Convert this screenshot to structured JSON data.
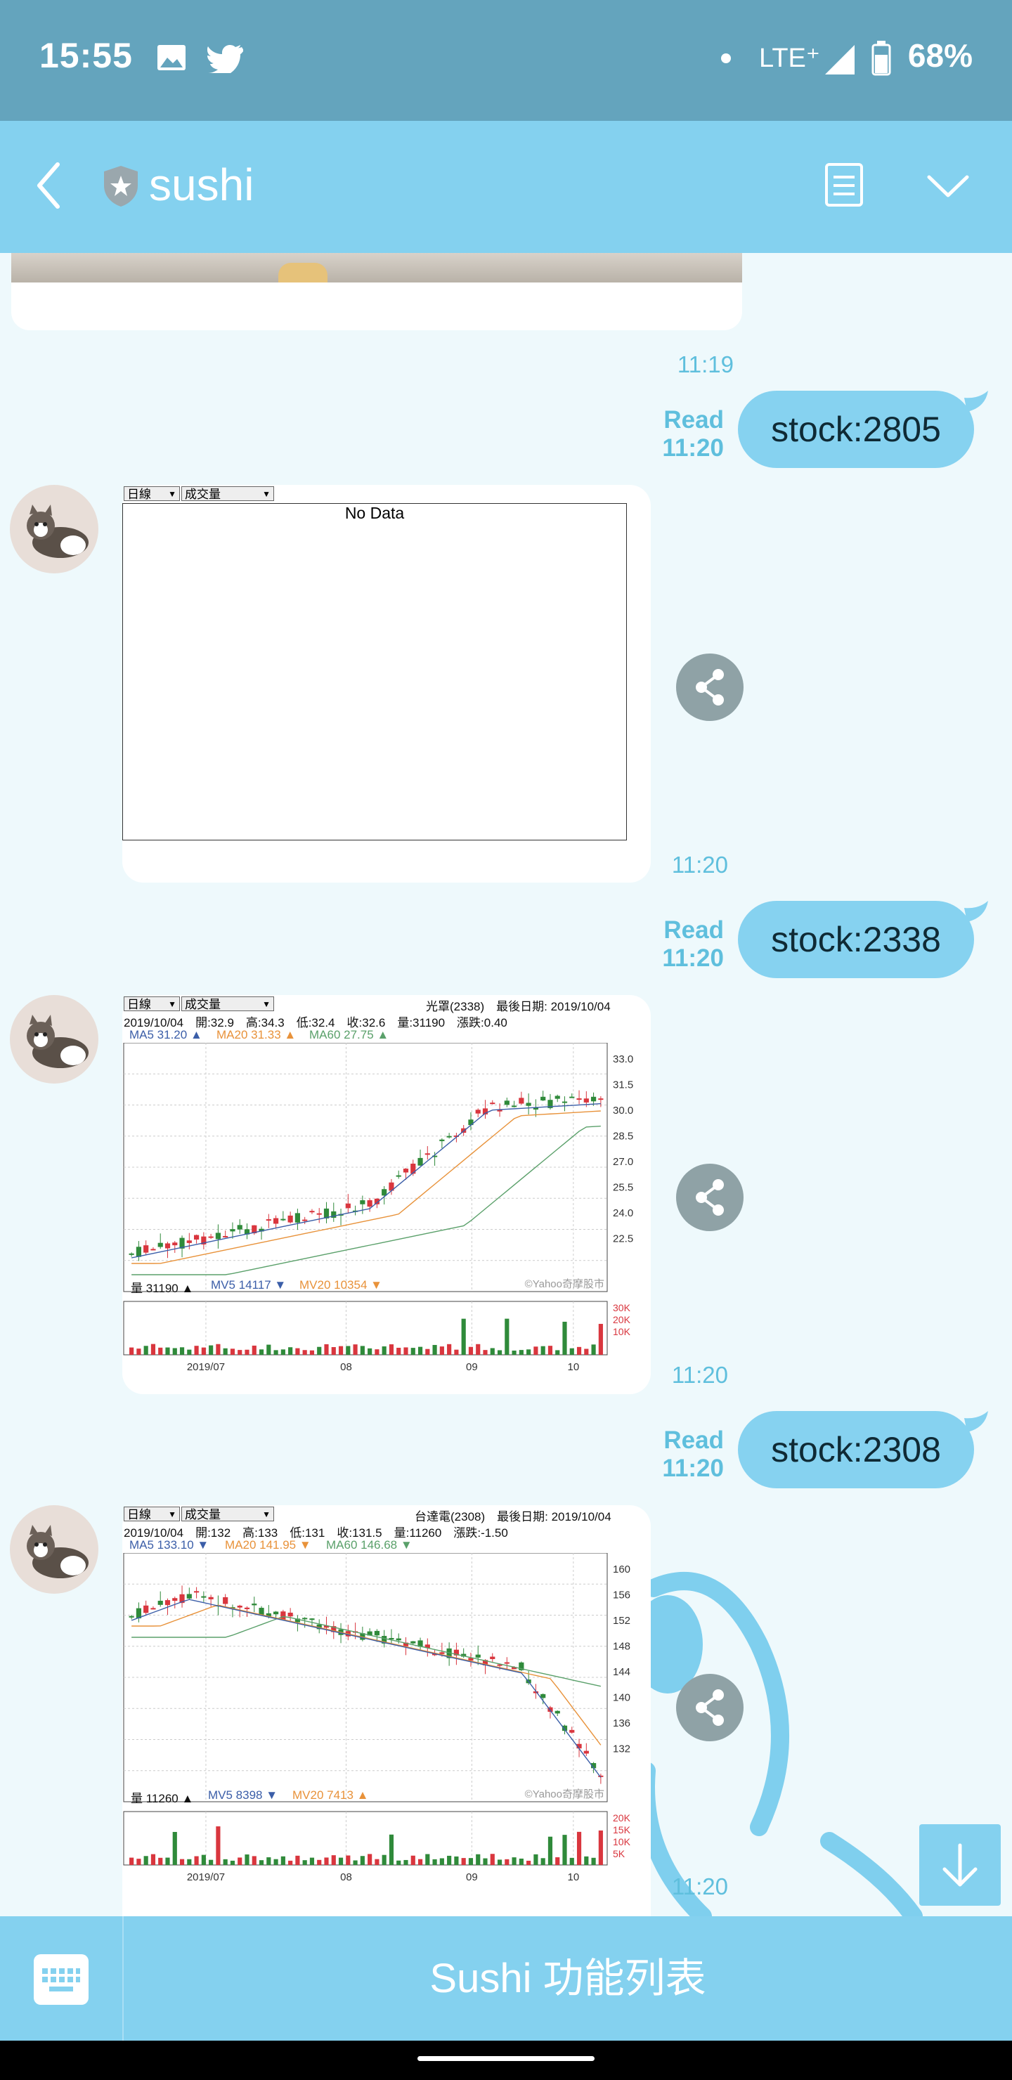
{
  "status": {
    "time": "15:55",
    "network": "LTE⁺",
    "battery": "68%"
  },
  "header": {
    "title": "sushi",
    "icons": [
      "back-arrow-icon",
      "shield-icon",
      "notes-icon",
      "chevron-down-icon"
    ]
  },
  "messages": {
    "m0_time": "11:19",
    "m1": {
      "read": "Read",
      "time": "11:20",
      "text": "stock:2805"
    },
    "m2": {
      "time": "11:20",
      "select1": "日線",
      "select2": "成交量",
      "no_data": "No Data"
    },
    "m3": {
      "read": "Read",
      "time": "11:20",
      "text": "stock:2338"
    },
    "m4": {
      "time": "11:20",
      "select1": "日線",
      "select2": "成交量",
      "title": "光罩(2338)　最後日期: 2019/10/04",
      "info": "2019/10/04　開:32.9　高:34.3　低:32.4　收:32.6　量:31190　漲跌:0.40",
      "ma5": "MA5 31.20 ▲",
      "ma20": "MA20 31.33 ▲",
      "ma60": "MA60 27.75 ▲",
      "vol": "量 31190 ▲",
      "mv5": "MV5 14117 ▼",
      "mv20": "MV20 10354 ▼",
      "watermark": "©Yahoo奇摩股市",
      "price_ticks": [
        "33.0",
        "31.5",
        "30.0",
        "28.5",
        "27.0",
        "25.5",
        "24.0",
        "22.5"
      ],
      "vol_ticks": [
        "30K",
        "20K",
        "10K"
      ],
      "x_ticks": [
        "2019/07",
        "08",
        "09",
        "10"
      ]
    },
    "m5": {
      "read": "Read",
      "time": "11:20",
      "text": "stock:2308"
    },
    "m6": {
      "time": "11:20",
      "select1": "日線",
      "select2": "成交量",
      "title": "台達電(2308)　最後日期: 2019/10/04",
      "info": "2019/10/04　開:132　高:133　低:131　收:131.5　量:11260　漲跌:-1.50",
      "ma5": "MA5 133.10 ▼",
      "ma20": "MA20 141.95 ▼",
      "ma60": "MA60 146.68 ▼",
      "vol": "量 11260 ▲",
      "mv5": "MV5 8398 ▼",
      "mv20": "MV20 7413 ▲",
      "watermark": "©Yahoo奇摩股市",
      "price_ticks": [
        "160",
        "156",
        "152",
        "148",
        "144",
        "140",
        "136",
        "132"
      ],
      "vol_ticks": [
        "20K",
        "15K",
        "10K",
        "5K"
      ],
      "x_ticks": [
        "2019/07",
        "08",
        "09",
        "10"
      ]
    }
  },
  "bottom": {
    "menu_label": "Sushi 功能列表"
  },
  "colors": {
    "accent": "#84d1ef",
    "statusbar": "#64a4bd",
    "up": "#d9363e",
    "down": "#2f8a3a",
    "ma5": "#3b5ea8",
    "ma20": "#e8923a",
    "ma60": "#5aa06a"
  }
}
